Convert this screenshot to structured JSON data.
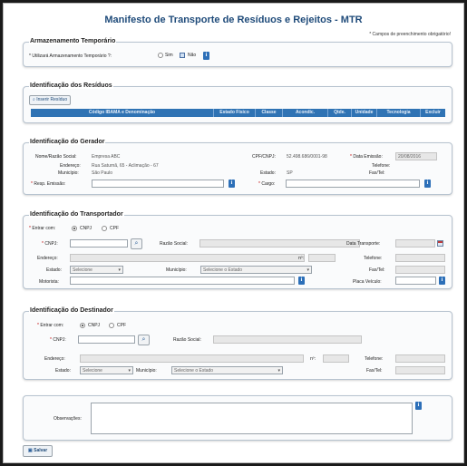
{
  "page": {
    "title": "Manifesto de Transporte de Resíduos e Rejeitos - MTR",
    "required_note": "* Campos de preenchimento obrigatório!"
  },
  "armazenamento": {
    "legend": "Armazenamento Temporário",
    "question": "* Utilizará Armazenamento Temporário ?:",
    "opt_sim": "Sim",
    "opt_nao": "Não",
    "selected": "Não"
  },
  "residuos": {
    "legend": "Identificação dos Resíduos",
    "insert_button": "Inserir Resíduo",
    "columns": [
      "Código IBAMA e Denominação",
      "Estado Físico",
      "Classe",
      "Acondic.",
      "Qtde.",
      "Unidade",
      "Tecnologia",
      "Excluir"
    ]
  },
  "gerador": {
    "legend": "Identificação do Gerador",
    "razao_label": "Nome/Razão Social:",
    "razao_value": "Empresa ABC",
    "endereco_label": "Endereço:",
    "endereco_value": "Rua Saturnã, 65 - Aclimação - 67",
    "municipio_label": "Município:",
    "municipio_value": "São Paulo",
    "cpf_label": "CPF/CNPJ:",
    "cpf_value": "52.498.686/0001-98",
    "estado_label": "Estado:",
    "estado_value": "SP",
    "data_label": "* Data Emissão:",
    "data_value": "20/08/2016",
    "telefone_label": "Telefone:",
    "fax_label": "Fax/Tel:",
    "resp_label": "* Resp. Emissão:",
    "cargo_label": "* Cargo:"
  },
  "transportador": {
    "legend": "Identificação do Transportador",
    "entrar_label": "* Entrar com:",
    "opt_cnpj": "CNPJ",
    "opt_cpf": "CPF",
    "cnpj_label": "* CNPJ:",
    "razao_label": "Razão Social:",
    "data_transporte_label": "Data Transporte:",
    "endereco_label": "Endereço:",
    "numero_label": "nº:",
    "telefone_label": "Telefone:",
    "estado_label": "Estado:",
    "estado_placeholder": "Selecione",
    "municipio_label": "Município:",
    "municipio_placeholder": "Selecione o Estado",
    "fax_label": "Fax/Tel:",
    "motorista_label": "Motorista:",
    "placa_label": "Placa Veículo:"
  },
  "destinador": {
    "legend": "Identificação do Destinador",
    "entrar_label": "* Entrar com:",
    "opt_cnpj": "CNPJ",
    "opt_cpf": "CPF",
    "cnpj_label": "* CNPJ:",
    "razao_label": "Razão Social:",
    "endereco_label": "Endereço:",
    "numero_label": "nº:",
    "telefone_label": "Telefone:",
    "estado_label": "Estado:",
    "estado_placeholder": "Selecione",
    "municipio_label": "Município:",
    "municipio_placeholder": "Selecione o Estado",
    "fax_label": "Fax/Tel:"
  },
  "observacoes": {
    "label": "Observações:"
  },
  "footer": {
    "save_label": "Salvar"
  },
  "colors": {
    "title": "#1f4b7a",
    "table_header": "#2f73b4",
    "info_icon": "#2c6fb8",
    "required": "#c00000"
  }
}
